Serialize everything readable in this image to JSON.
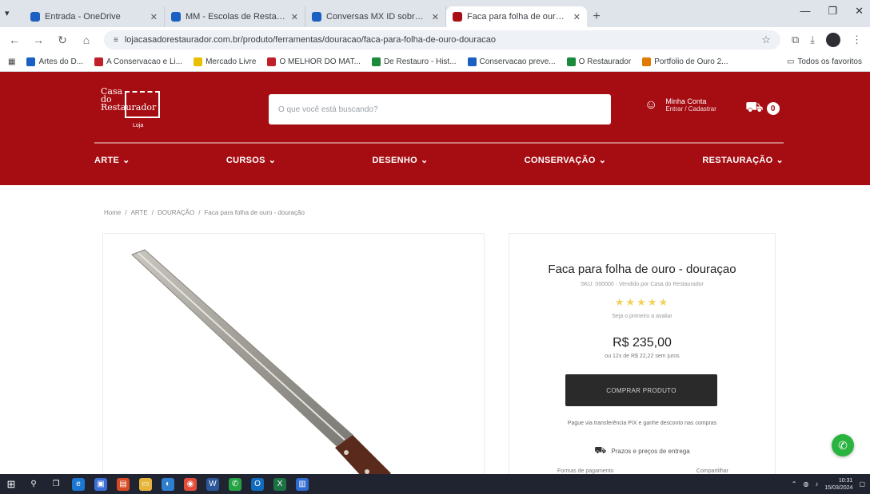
{
  "browser": {
    "tabs": [
      {
        "title": "Entrada - OneDrive"
      },
      {
        "title": "MM - Escolas de Restauro..."
      },
      {
        "title": "Conversas MX ID sobre..."
      },
      {
        "title": "Faca para folha de ouro - dou..."
      }
    ],
    "url": "lojacasadorestaurador.com.br/produto/ferramentas/douracao/faca-para-folha-de-ouro-douracao",
    "bookmarks": [
      {
        "label": "Artes do D...",
        "color": "#1a5fc2"
      },
      {
        "label": "A Conservacao e Li...",
        "color": "#c0202a"
      },
      {
        "label": "Mercado Livre",
        "color": "#e8c000"
      },
      {
        "label": "O MELHOR DO MAT...",
        "color": "#c0202a"
      },
      {
        "label": "De Restauro - Hist...",
        "color": "#1b8a3a"
      },
      {
        "label": "Conservacao preve...",
        "color": "#1a5fc2"
      },
      {
        "label": "O Restaurador",
        "color": "#1b8a3a"
      },
      {
        "label": "Portfolio de Ouro 2...",
        "color": "#e07a00"
      }
    ],
    "bookmarks_more": "Todos os favoritos"
  },
  "site": {
    "logo_lines": [
      "Casa",
      "do",
      "Restaurador"
    ],
    "logo_sub": "Loja",
    "search_placeholder": "O que você está buscando?",
    "account_line1": "Minha Conta",
    "account_line2": "Entrar / Cadastrar",
    "cart_count": "0",
    "menu": [
      "ARTE",
      "CURSOS",
      "DESENHO",
      "CONSERVAÇÃO",
      "RESTAURAÇÃO"
    ]
  },
  "breadcrumb": [
    "Home",
    "/",
    "ARTE",
    "/",
    "DOURAÇÃO",
    "/",
    "Faca para folha de ouro - douração"
  ],
  "product": {
    "title": "Faca para folha de ouro - douraçao",
    "meta": "SKU: 000000 · Vendido por Casa do Restaurador",
    "stars": "★★★★★",
    "reviews": "Seja o primeiro a avaliar",
    "price": "R$ 235,00",
    "installments": "ou 12x de R$ 22,22 sem juros",
    "buy_label": "COMPRAR PRODUTO",
    "note": "Pague via transferência PIX e ganhe desconto nas compras",
    "delivery": "Prazos e preços de entrega",
    "footer_left": "Formas de pagamento",
    "footer_right": "Compartilhar"
  },
  "taskbar": {
    "time": "10:31",
    "date": "15/03/2024"
  }
}
